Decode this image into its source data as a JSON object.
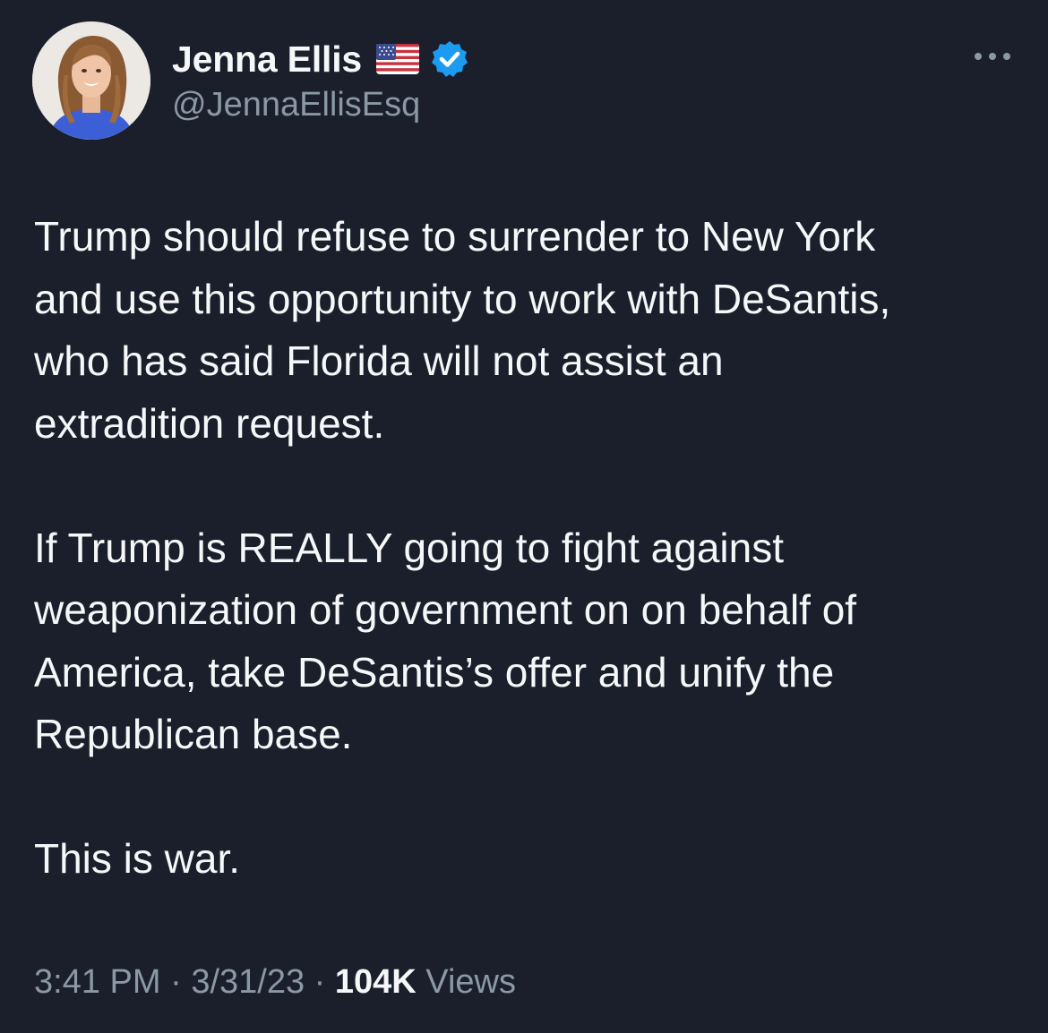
{
  "author": {
    "display_name": "Jenna Ellis",
    "handle": "@JennaEllisEsq",
    "flag_icon": "us-flag-icon",
    "verified_icon": "verified-badge-icon",
    "verified_color": "#1d9bf0"
  },
  "menu": {
    "icon": "more-options-icon"
  },
  "tweet": {
    "paragraphs": [
      "Trump should refuse to surrender to New York\nand use this opportunity to work with DeSantis,\nwho has said Florida will not assist an\nextradition request.",
      "If Trump is REALLY going to fight against\nweaponization of government on on behalf of\nAmerica, take DeSantis’s offer and unify the\nRepublican base.",
      "This is war."
    ]
  },
  "meta": {
    "time": "3:41 PM",
    "date": "3/31/23",
    "separator": "·",
    "views_count": "104K",
    "views_label": "Views"
  },
  "colors": {
    "background": "#1a1f2b",
    "text_primary": "#f5f7f9",
    "text_secondary": "#8b98a5"
  }
}
